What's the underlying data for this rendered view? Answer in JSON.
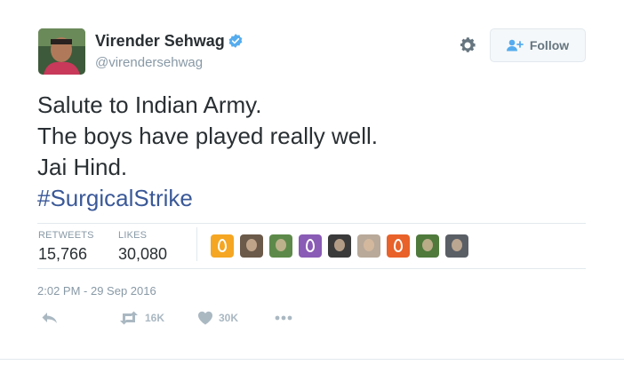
{
  "author": {
    "name": "Virender Sehwag",
    "handle": "@virendersehwag",
    "verified": true,
    "verified_color": "#55acee"
  },
  "header": {
    "follow_label": "Follow",
    "settings_icon": "gear-icon"
  },
  "tweet": {
    "lines": [
      "Salute to Indian Army.",
      "The boys have played really well.",
      "Jai Hind."
    ],
    "hashtag": "#SurgicalStrike",
    "hashtag_color": "#3b5998"
  },
  "stats": {
    "retweets_label": "RETWEETS",
    "retweets_value": "15,766",
    "likes_label": "LIKES",
    "likes_value": "30,080"
  },
  "likers": [
    {
      "kind": "egg",
      "color": "#f5a623"
    },
    {
      "kind": "photo",
      "color": "#6b5a49"
    },
    {
      "kind": "photo",
      "color": "#5d8a4a"
    },
    {
      "kind": "egg",
      "color": "#8a5cb5"
    },
    {
      "kind": "photo",
      "color": "#3a3a3a"
    },
    {
      "kind": "photo",
      "color": "#b8a999"
    },
    {
      "kind": "egg",
      "color": "#e8622a"
    },
    {
      "kind": "photo",
      "color": "#4f7a3c"
    },
    {
      "kind": "photo",
      "color": "#5a5f66"
    }
  ],
  "timestamp": "2:02 PM - 29 Sep 2016",
  "actions": {
    "reply_icon": "reply-icon",
    "retweet_icon": "retweet-icon",
    "retweet_count": "16K",
    "like_icon": "heart-icon",
    "like_count": "30K",
    "more_icon": "more-icon"
  },
  "colors": {
    "text": "#292f33",
    "muted": "#8899a6",
    "action": "#aab8c2",
    "border": "#e1e8ed"
  }
}
